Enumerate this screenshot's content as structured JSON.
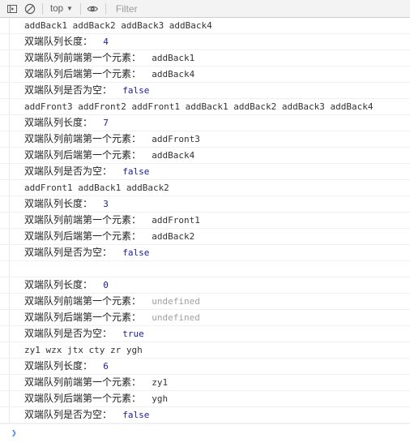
{
  "toolbar": {
    "drawer_toggle_title": "Show console sidebar",
    "clear_title": "Clear console",
    "context_selector": "top",
    "context_caret": "▼",
    "eye_title": "Create live expression",
    "filter": {
      "placeholder": "Filter",
      "value": ""
    }
  },
  "console": {
    "prompt_symbol": "❯",
    "prompt_value": "",
    "rows": [
      {
        "type": "plain",
        "text": "addBack1 addBack2 addBack3 addBack4"
      },
      {
        "type": "kv",
        "label": "双端队列长度：",
        "value": "4",
        "value_kind": "num"
      },
      {
        "type": "kv",
        "label": "双端队列前端第一个元素：",
        "value": "addBack1",
        "value_kind": "str"
      },
      {
        "type": "kv",
        "label": "双端队列后端第一个元素：",
        "value": "addBack4",
        "value_kind": "str"
      },
      {
        "type": "kv",
        "label": "双端队列是否为空：",
        "value": "false",
        "value_kind": "bool"
      },
      {
        "type": "plain",
        "text": "addFront3 addFront2 addFront1 addBack1 addBack2 addBack3 addBack4"
      },
      {
        "type": "kv",
        "label": "双端队列长度：",
        "value": "7",
        "value_kind": "num"
      },
      {
        "type": "kv",
        "label": "双端队列前端第一个元素：",
        "value": "addFront3",
        "value_kind": "str"
      },
      {
        "type": "kv",
        "label": "双端队列后端第一个元素：",
        "value": "addBack4",
        "value_kind": "str"
      },
      {
        "type": "kv",
        "label": "双端队列是否为空：",
        "value": "false",
        "value_kind": "bool"
      },
      {
        "type": "plain",
        "text": "addFront1 addBack1 addBack2"
      },
      {
        "type": "kv",
        "label": "双端队列长度：",
        "value": "3",
        "value_kind": "num"
      },
      {
        "type": "kv",
        "label": "双端队列前端第一个元素：",
        "value": "addFront1",
        "value_kind": "str"
      },
      {
        "type": "kv",
        "label": "双端队列后端第一个元素：",
        "value": "addBack2",
        "value_kind": "str"
      },
      {
        "type": "kv",
        "label": "双端队列是否为空：",
        "value": "false",
        "value_kind": "bool"
      },
      {
        "type": "plain",
        "text": ""
      },
      {
        "type": "kv",
        "label": "双端队列长度：",
        "value": "0",
        "value_kind": "num"
      },
      {
        "type": "kv",
        "label": "双端队列前端第一个元素：",
        "value": "undefined",
        "value_kind": "undef"
      },
      {
        "type": "kv",
        "label": "双端队列后端第一个元素：",
        "value": "undefined",
        "value_kind": "undef"
      },
      {
        "type": "kv",
        "label": "双端队列是否为空：",
        "value": "true",
        "value_kind": "bool"
      },
      {
        "type": "plain",
        "text": "zy1 wzx jtx cty zr ygh"
      },
      {
        "type": "kv",
        "label": "双端队列长度：",
        "value": "6",
        "value_kind": "num"
      },
      {
        "type": "kv",
        "label": "双端队列前端第一个元素：",
        "value": "zy1",
        "value_kind": "str"
      },
      {
        "type": "kv",
        "label": "双端队列后端第一个元素：",
        "value": "ygh",
        "value_kind": "str"
      },
      {
        "type": "kv",
        "label": "双端队列是否为空：",
        "value": "false",
        "value_kind": "bool"
      }
    ]
  },
  "colors": {
    "value_blue": "#1a1aa6",
    "undefined_gray": "#a0a0a0",
    "prompt_blue": "#3b78e7",
    "toolbar_bg": "#f3f3f3",
    "row_border": "#f0f0f0"
  }
}
